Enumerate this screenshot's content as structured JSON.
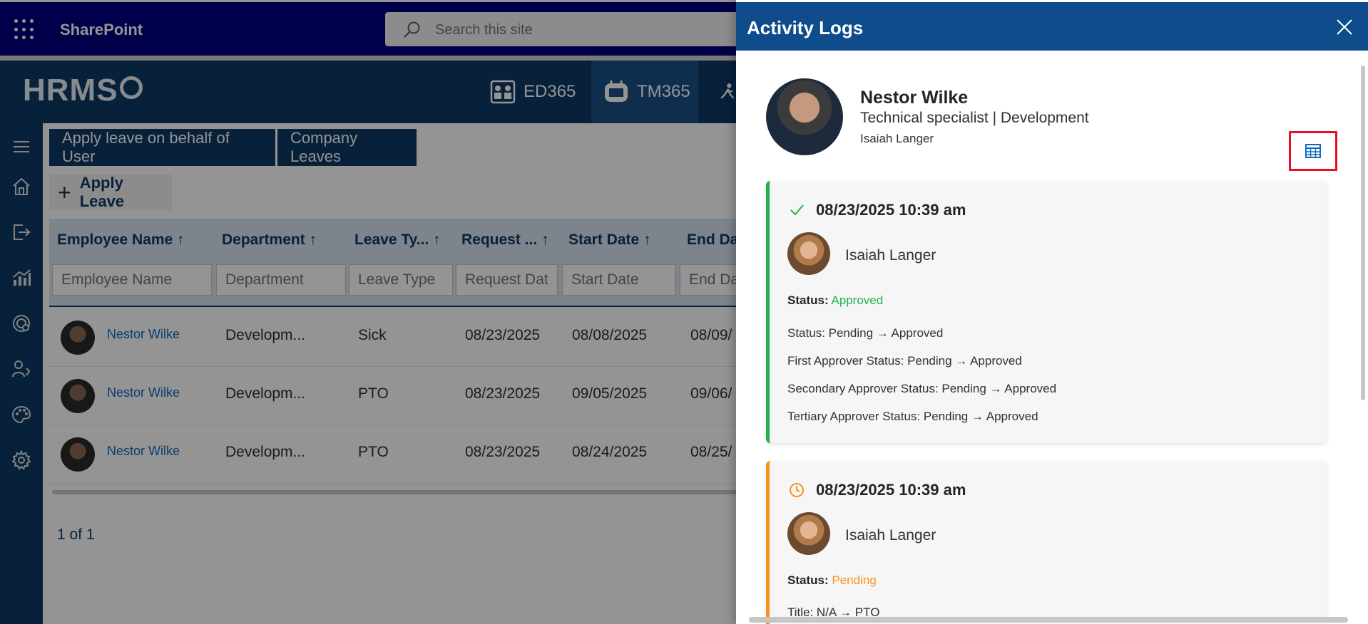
{
  "suitebar": {
    "app_name": "SharePoint",
    "search_placeholder": "Search this site"
  },
  "hrms": {
    "logo": "HRMS",
    "tabs": [
      {
        "label": "ED365",
        "active": false
      },
      {
        "label": "TM365",
        "active": true
      }
    ]
  },
  "leftrail": {
    "icons": [
      "hamburger-icon",
      "home-icon",
      "logout-icon",
      "analytics-icon",
      "settings-radar-icon",
      "user-settings-icon",
      "palette-icon",
      "gear-icon"
    ]
  },
  "toolbar": {
    "apply_behalf_label": "Apply leave on behalf of User",
    "company_leaves_label": "Company Leaves",
    "apply_leave_label": "Apply Leave"
  },
  "grid": {
    "columns": [
      "Employee Name ↑",
      "Department ↑",
      "Leave Ty... ↑",
      "Request ... ↑",
      "Start Date ↑",
      "End Da"
    ],
    "filters": [
      "Employee Name",
      "Department",
      "Leave Type",
      "Request Dat",
      "Start Date",
      "End Da"
    ],
    "rows": [
      {
        "name": "Nestor Wilke",
        "department": "Developm...",
        "leave_type": "Sick",
        "request": "08/23/2025",
        "start": "08/08/2025",
        "end": "08/09/"
      },
      {
        "name": "Nestor Wilke",
        "department": "Developm...",
        "leave_type": "PTO",
        "request": "08/23/2025",
        "start": "09/05/2025",
        "end": "09/06/"
      },
      {
        "name": "Nestor Wilke",
        "department": "Developm...",
        "leave_type": "PTO",
        "request": "08/23/2025",
        "start": "08/24/2025",
        "end": "08/25/"
      }
    ],
    "pager": "1 of 1"
  },
  "panel": {
    "title": "Activity Logs",
    "profile": {
      "name": "Nestor Wilke",
      "role": "Technical specialist | Development",
      "manager": "Isaiah Langer"
    },
    "logs": [
      {
        "timestamp": "08/23/2025 10:39 am",
        "actor": "Isaiah Langer",
        "status_label": "Status:",
        "status_value": "Approved",
        "status_color": "#22b14c",
        "changes": [
          "Status: Pending → Approved",
          "First Approver Status: Pending → Approved",
          "Secondary Approver Status: Pending → Approved",
          "Tertiary Approver Status: Pending → Approved"
        ]
      },
      {
        "timestamp": "08/23/2025 10:39 am",
        "actor": "Isaiah Langer",
        "status_label": "Status:",
        "status_value": "Pending",
        "status_color": "#f7941d",
        "changes": [
          "Title: N/A → PTO"
        ]
      }
    ]
  }
}
